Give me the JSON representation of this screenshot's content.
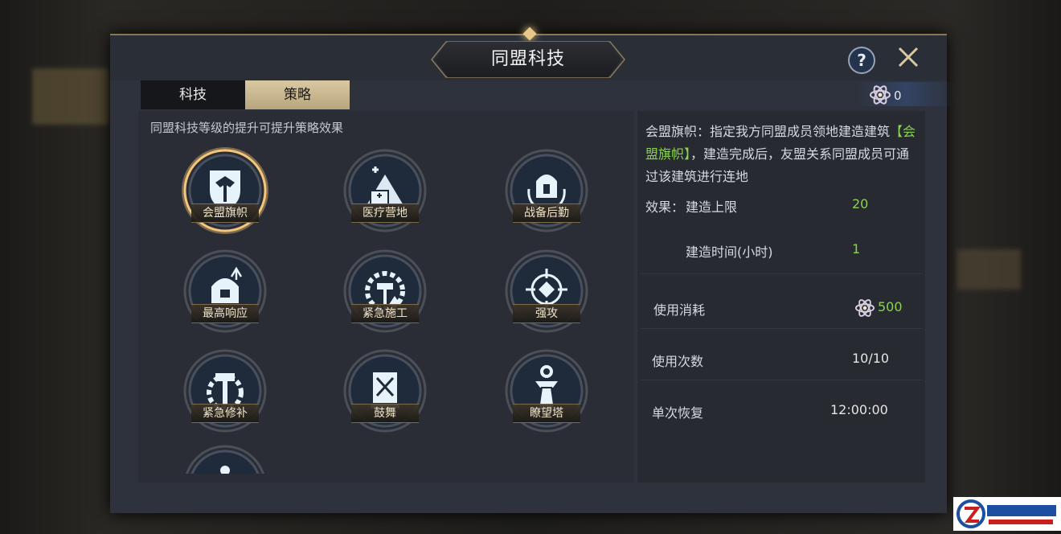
{
  "window": {
    "title": "同盟科技"
  },
  "tabs": [
    {
      "label": "科技",
      "active": false
    },
    {
      "label": "策略",
      "active": true
    }
  ],
  "points": {
    "icon": "atom-icon",
    "value": "0"
  },
  "hint": "同盟科技等级的提升可提升策略效果",
  "nodes": [
    {
      "label": "会盟旗帜",
      "icon": "shield-eagle-icon",
      "selected": true
    },
    {
      "label": "医疗营地",
      "icon": "medical-tent-icon",
      "selected": false
    },
    {
      "label": "战备后勤",
      "icon": "helmet-laurel-icon",
      "selected": false
    },
    {
      "label": "最高响应",
      "icon": "helmet-arrows-icon",
      "selected": false
    },
    {
      "label": "紧急施工",
      "icon": "gear-hammer-icon",
      "selected": false
    },
    {
      "label": "强攻",
      "icon": "crosshair-helmet-icon",
      "selected": false
    },
    {
      "label": "紧急修补",
      "icon": "gear-wrench-icon",
      "selected": false
    },
    {
      "label": "鼓舞",
      "icon": "banner-icon",
      "selected": false
    },
    {
      "label": "瞭望塔",
      "icon": "watchtower-icon",
      "selected": false
    }
  ],
  "detail": {
    "name": "会盟旗帜",
    "desc_part1": "：指定我方同盟成员领地建造建筑",
    "desc_highlight": "【会盟旗帜】",
    "desc_part2": "，建造完成后，友盟关系同盟成员可通过该建筑进行连地",
    "effect_label": "效果：",
    "effects": [
      {
        "label": "建造上限",
        "value": "20"
      },
      {
        "label": "建造时间(小时)",
        "value": "1"
      }
    ],
    "cost_label": "使用消耗",
    "cost_value": "500",
    "uses_label": "使用次数",
    "uses_value": "10/10",
    "recover_label": "单次恢复",
    "recover_value": "12:00:00"
  },
  "colors": {
    "accent_gold": "#c9a96a",
    "value_green": "#8bd152",
    "panel_bg": "#2e323c"
  }
}
